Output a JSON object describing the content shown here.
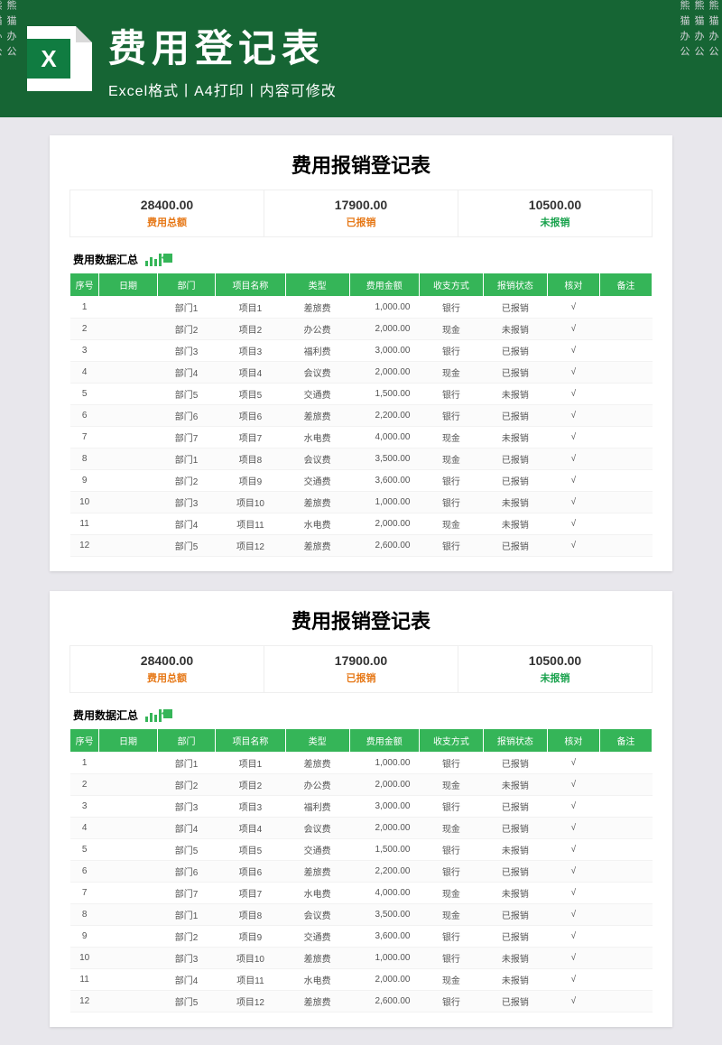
{
  "banner": {
    "icon_letter": "X",
    "title": "费用登记表",
    "subtitle": "Excel格式丨A4打印丨内容可修改"
  },
  "watermark_text": "熊猫办公",
  "doc": {
    "title": "费用报销登记表",
    "summary": [
      {
        "value": "28400.00",
        "label": "费用总额",
        "color": "orange"
      },
      {
        "value": "17900.00",
        "label": "已报销",
        "color": "orange"
      },
      {
        "value": "10500.00",
        "label": "未报销",
        "color": "green"
      }
    ],
    "section_title": "费用数据汇总",
    "columns": [
      "序号",
      "日期",
      "部门",
      "项目名称",
      "类型",
      "费用金额",
      "收支方式",
      "报销状态",
      "核对",
      "备注"
    ],
    "rows": [
      {
        "seq": "1",
        "date": "",
        "dept": "部门1",
        "proj": "项目1",
        "type": "差旅费",
        "amt": "1,000.00",
        "pay": "银行",
        "stat": "已报销",
        "chk": "√",
        "note": ""
      },
      {
        "seq": "2",
        "date": "",
        "dept": "部门2",
        "proj": "项目2",
        "type": "办公费",
        "amt": "2,000.00",
        "pay": "现金",
        "stat": "未报销",
        "chk": "√",
        "note": ""
      },
      {
        "seq": "3",
        "date": "",
        "dept": "部门3",
        "proj": "项目3",
        "type": "福利费",
        "amt": "3,000.00",
        "pay": "银行",
        "stat": "已报销",
        "chk": "√",
        "note": ""
      },
      {
        "seq": "4",
        "date": "",
        "dept": "部门4",
        "proj": "项目4",
        "type": "会议费",
        "amt": "2,000.00",
        "pay": "现金",
        "stat": "已报销",
        "chk": "√",
        "note": ""
      },
      {
        "seq": "5",
        "date": "",
        "dept": "部门5",
        "proj": "项目5",
        "type": "交通费",
        "amt": "1,500.00",
        "pay": "银行",
        "stat": "未报销",
        "chk": "√",
        "note": ""
      },
      {
        "seq": "6",
        "date": "",
        "dept": "部门6",
        "proj": "项目6",
        "type": "差旅费",
        "amt": "2,200.00",
        "pay": "银行",
        "stat": "已报销",
        "chk": "√",
        "note": ""
      },
      {
        "seq": "7",
        "date": "",
        "dept": "部门7",
        "proj": "项目7",
        "type": "水电费",
        "amt": "4,000.00",
        "pay": "现金",
        "stat": "未报销",
        "chk": "√",
        "note": ""
      },
      {
        "seq": "8",
        "date": "",
        "dept": "部门1",
        "proj": "项目8",
        "type": "会议费",
        "amt": "3,500.00",
        "pay": "现金",
        "stat": "已报销",
        "chk": "√",
        "note": ""
      },
      {
        "seq": "9",
        "date": "",
        "dept": "部门2",
        "proj": "项目9",
        "type": "交通费",
        "amt": "3,600.00",
        "pay": "银行",
        "stat": "已报销",
        "chk": "√",
        "note": ""
      },
      {
        "seq": "10",
        "date": "",
        "dept": "部门3",
        "proj": "项目10",
        "type": "差旅费",
        "amt": "1,000.00",
        "pay": "银行",
        "stat": "未报销",
        "chk": "√",
        "note": ""
      },
      {
        "seq": "11",
        "date": "",
        "dept": "部门4",
        "proj": "项目11",
        "type": "水电费",
        "amt": "2,000.00",
        "pay": "现金",
        "stat": "未报销",
        "chk": "√",
        "note": ""
      },
      {
        "seq": "12",
        "date": "",
        "dept": "部门5",
        "proj": "项目12",
        "type": "差旅费",
        "amt": "2,600.00",
        "pay": "银行",
        "stat": "已报销",
        "chk": "√",
        "note": ""
      }
    ]
  }
}
